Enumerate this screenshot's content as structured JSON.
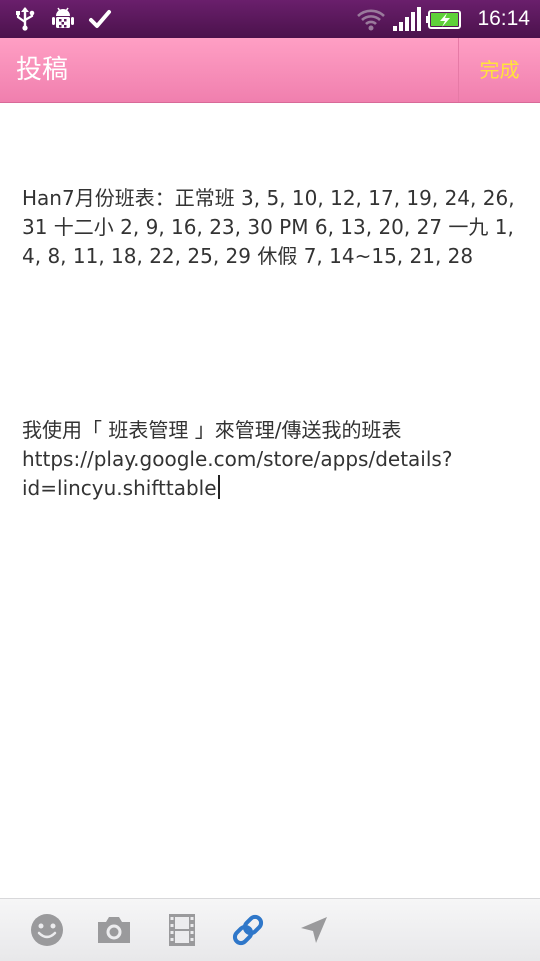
{
  "status_bar": {
    "time": "16:14",
    "icons": [
      "usb-icon",
      "android-debug-icon",
      "checkmark-icon",
      "wifi-icon",
      "signal-icon",
      "battery-charging-icon"
    ]
  },
  "header": {
    "title": "投稿",
    "done_label": "完成"
  },
  "editor": {
    "paragraph_1": "Han7月份班表：正常班 3, 5, 10, 12, 17, 19, 24, 26, 31 十二小 2, 9, 16, 23, 30 PM 6, 13, 20, 27 一九 1, 4, 8, 11, 18, 22, 25, 29 休假 7, 14~15, 21, 28",
    "paragraph_2": "我使用「 班表管理 」來管理/傳送我的班表 https://play.google.com/store/apps/details?id=lincyu.shifttable"
  },
  "toolbar": {
    "icons": [
      "emoji-icon",
      "camera-icon",
      "video-icon",
      "link-icon",
      "location-icon"
    ]
  },
  "colors": {
    "status_bar": "#5a1a5c",
    "title_bar": "#f58cb6",
    "done_text": "#ffe33b",
    "link_icon": "#2f77c9",
    "toolbar_icon": "#9a9a9c"
  }
}
